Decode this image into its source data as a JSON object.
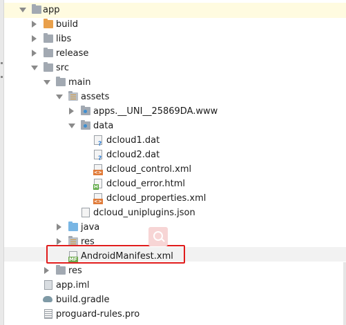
{
  "tree": {
    "app": "app",
    "build": "build",
    "libs": "libs",
    "release": "release",
    "src": "src",
    "main": "main",
    "assets": "assets",
    "apps_folder": "apps.__UNI__25869DA.www",
    "data": "data",
    "dcloud1": "dcloud1.dat",
    "dcloud2": "dcloud2.dat",
    "dcloud_control": "dcloud_control.xml",
    "dcloud_error": "dcloud_error.html",
    "dcloud_properties": "dcloud_properties.xml",
    "dcloud_uniplugins": "dcloud_uniplugins.json",
    "java": "java",
    "res_main": "res",
    "manifest": "AndroidManifest.xml",
    "res_src": "res",
    "app_iml": "app.iml",
    "build_gradle": "build.gradle",
    "proguard": "proguard-rules.pro"
  },
  "colors": {
    "highlight_box": "#e01b1b",
    "folder_orange": "#e9a04b",
    "folder_blue": "#79b6e4"
  }
}
